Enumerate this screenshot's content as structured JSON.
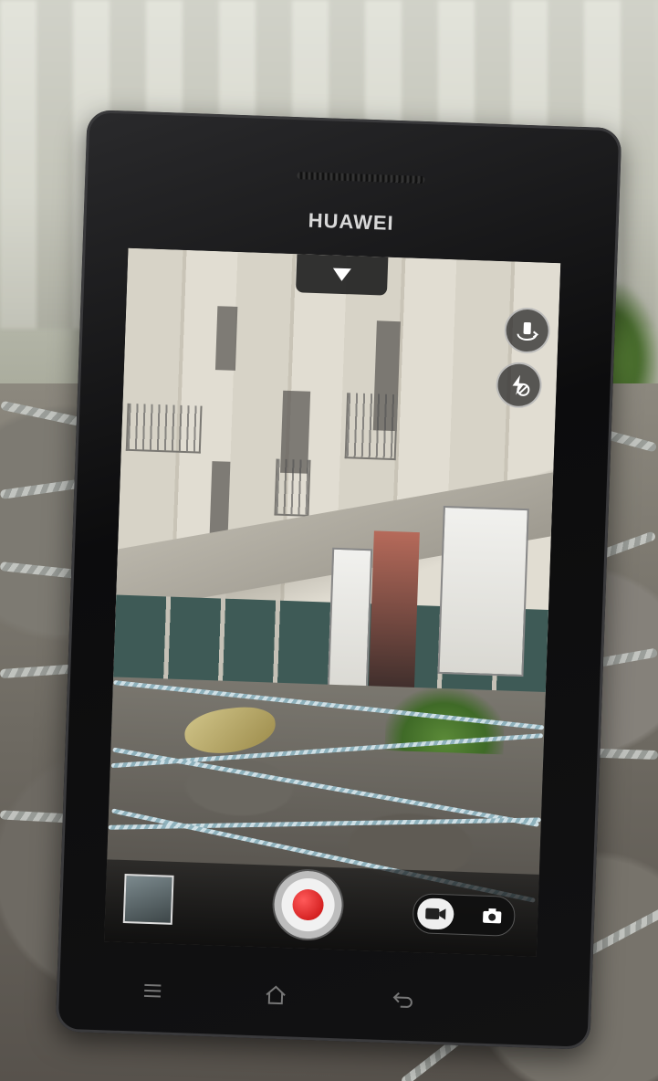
{
  "phone": {
    "brand": "HUAWEI"
  },
  "camera_ui": {
    "mode": "video",
    "icons": {
      "switch_camera": "switch-camera-icon",
      "flash_off": "flash-off-icon",
      "record": "record-icon",
      "video_mode": "video-camera-icon",
      "photo_mode": "camera-icon",
      "menu": "menu-icon",
      "home": "home-icon",
      "back": "back-icon"
    }
  },
  "colors": {
    "record_red": "#d01010",
    "phone_body": "#111111"
  }
}
